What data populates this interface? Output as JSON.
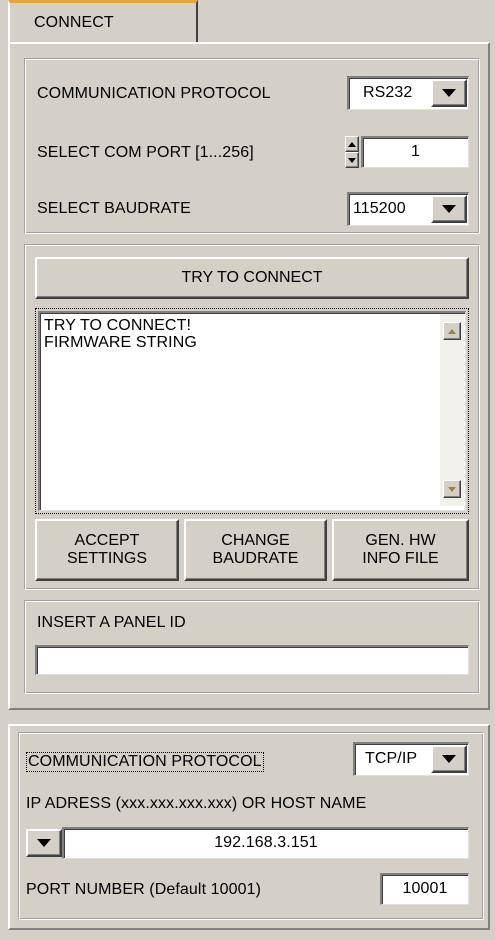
{
  "tab": {
    "label": "CONNECT"
  },
  "serial": {
    "protocol_label": "COMMUNICATION PROTOCOL",
    "protocol_value": "RS232",
    "com_port_label": "SELECT COM PORT [1...256]",
    "com_port_value": "1",
    "baudrate_label": "SELECT BAUDRATE",
    "baudrate_value": "115200"
  },
  "connect": {
    "try_button": "TRY TO CONNECT",
    "log_lines": [
      "TRY TO CONNECT!",
      "FIRMWARE STRING"
    ],
    "accept_line1": "ACCEPT",
    "accept_line2": "SETTINGS",
    "change_line1": "CHANGE",
    "change_line2": "BAUDRATE",
    "genhw_line1": "GEN. HW",
    "genhw_line2": "INFO FILE"
  },
  "panel_id": {
    "label": "INSERT A PANEL ID",
    "value": ""
  },
  "tcp": {
    "protocol_label": "COMMUNICATION PROTOCOL",
    "protocol_value": "TCP/IP",
    "ip_label": "IP ADRESS (xxx.xxx.xxx.xxx)  OR HOST NAME",
    "ip_value": "192.168.3.151",
    "port_label": "PORT NUMBER (Default 10001)",
    "port_value": "10001"
  },
  "colors": {
    "panel_bg": "#d4d0c8",
    "tab_accent": "#e8a33c"
  }
}
